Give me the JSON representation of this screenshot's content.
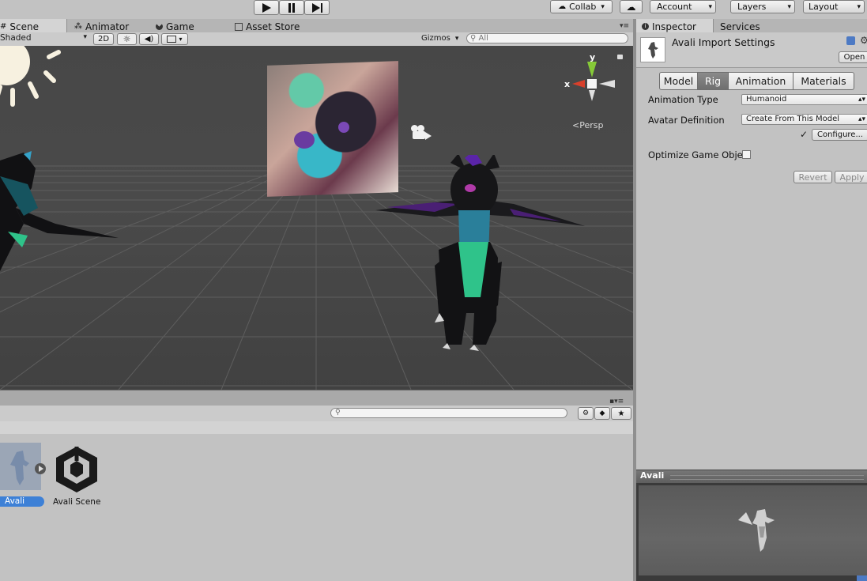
{
  "toolbar": {
    "play_icon": "play-icon",
    "pause_icon": "pause-icon",
    "step_icon": "step-icon",
    "collab_label": "Collab",
    "account_label": "Account",
    "layers_label": "Layers",
    "layout_label": "Layout"
  },
  "scene_tabs": [
    {
      "label": "Scene",
      "icon": "hash-icon"
    },
    {
      "label": "Animator",
      "icon": "animator-icon"
    },
    {
      "label": "Game",
      "icon": "pacman-icon"
    },
    {
      "label": "Asset Store",
      "icon": "store-icon"
    }
  ],
  "scene_toolbar": {
    "draw_mode": "Shaded",
    "mode_2d": "2D",
    "gizmos_label": "Gizmos",
    "search_placeholder": "All"
  },
  "viewport": {
    "projection_label": "Persp",
    "axis_x": "x",
    "axis_y": "y"
  },
  "project": {
    "assets": [
      {
        "label": "Avali",
        "selected": true
      },
      {
        "label": "Avali Scene",
        "selected": false
      }
    ]
  },
  "inspector": {
    "tab_label": "Inspector",
    "services_label": "Services",
    "title": "Avali Import Settings",
    "open_label": "Open",
    "tabs": [
      "Model",
      "Rig",
      "Animation",
      "Materials"
    ],
    "active_tab": "Rig",
    "animation_type_label": "Animation Type",
    "animation_type_value": "Humanoid",
    "avatar_def_label": "Avatar Definition",
    "avatar_def_value": "Create From This Model",
    "configure_check": "✓",
    "configure_label": "Configure...",
    "optimize_label": "Optimize Game Obje",
    "revert_label": "Revert",
    "apply_label": "Apply"
  },
  "preview": {
    "title": "Avali"
  }
}
